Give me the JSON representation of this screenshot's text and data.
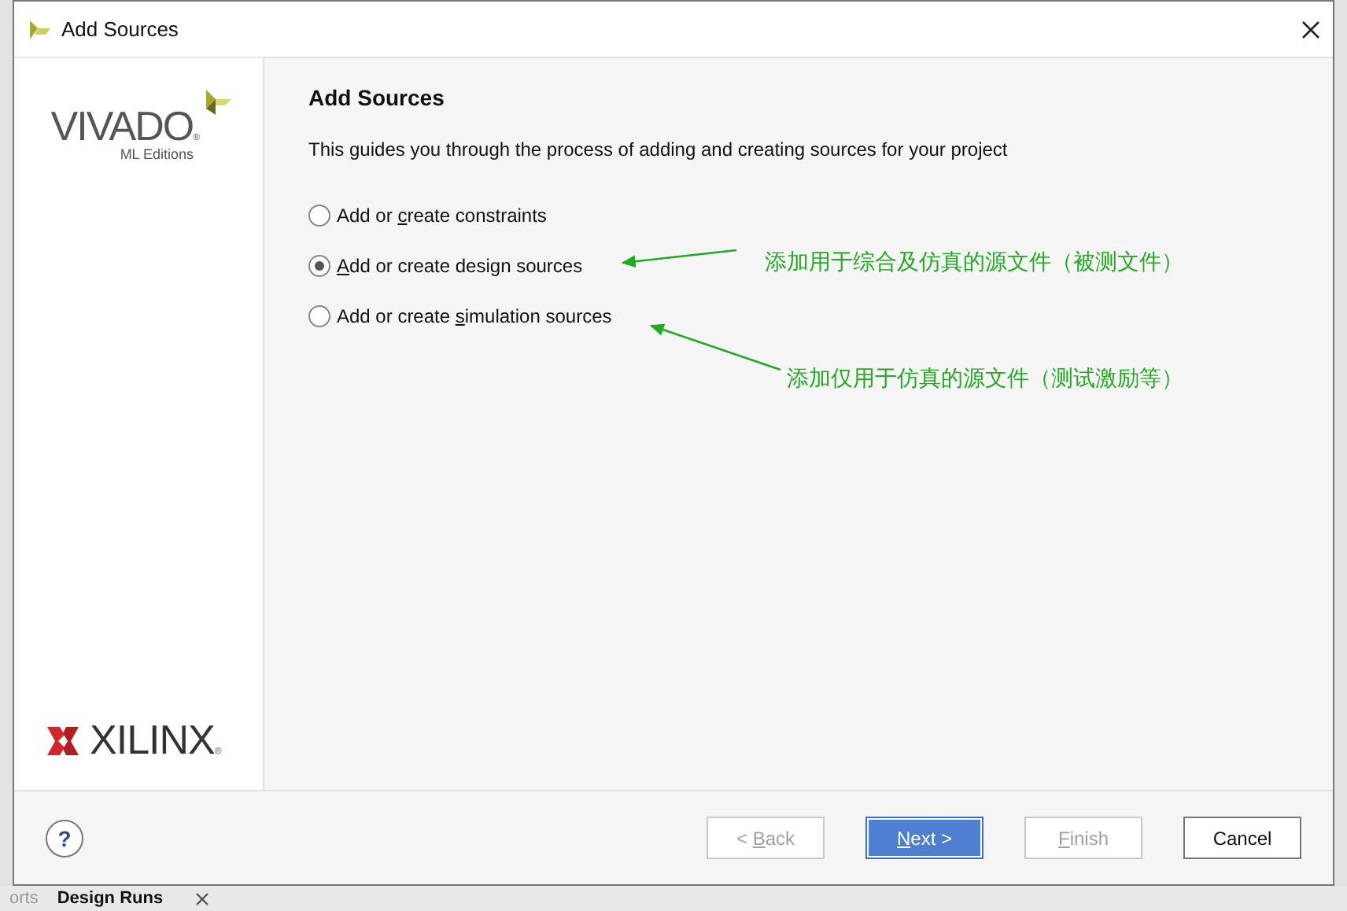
{
  "window": {
    "title": "Add Sources"
  },
  "branding": {
    "product": "VIVADO",
    "mark": "®",
    "edition": "ML Editions",
    "company": "XILINX"
  },
  "page": {
    "heading": "Add Sources",
    "description": "This guides you through the process of adding and creating sources for your project"
  },
  "options": [
    {
      "label": {
        "before": "Add or ",
        "key": "c",
        "after": "reate constraints"
      },
      "selected": false
    },
    {
      "label": {
        "key": "A",
        "after": "dd or create design sources"
      },
      "selected": true
    },
    {
      "label": {
        "before": "Add or create ",
        "key": "s",
        "after": "imulation sources"
      },
      "selected": false
    }
  ],
  "annotations": [
    "添加用于综合及仿真的源文件（被测文件）",
    "添加仅用于仿真的源文件（测试激励等）"
  ],
  "buttons": [
    {
      "label": {
        "before": "< ",
        "key": "B",
        "after": "ack"
      },
      "disabled": true,
      "default": false
    },
    {
      "label": {
        "key": "N",
        "after": "ext >"
      },
      "disabled": false,
      "default": true
    },
    {
      "label": {
        "key": "F",
        "after": "inish"
      },
      "disabled": true,
      "default": false
    },
    {
      "label": {
        "before": "Cancel"
      },
      "disabled": false,
      "default": false
    }
  ],
  "help_button": "?",
  "background_tabs": [
    "orts",
    "Design Runs"
  ]
}
